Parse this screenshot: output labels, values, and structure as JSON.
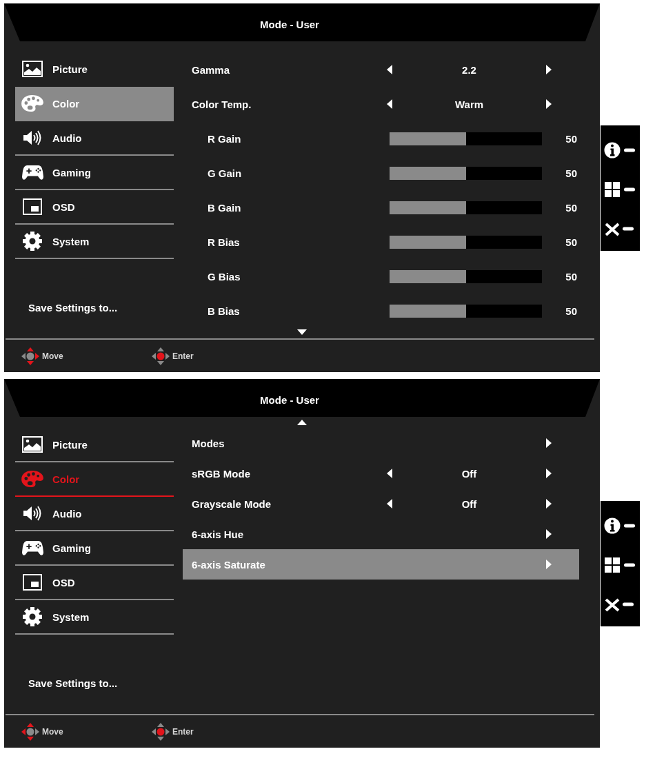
{
  "panels": [
    {
      "title": "Mode - User",
      "scroll_up": false,
      "scroll_down": true,
      "sidebar": {
        "active": true,
        "items": [
          {
            "label": "Picture",
            "selected": false
          },
          {
            "label": "Color",
            "selected": true
          },
          {
            "label": "Audio",
            "selected": false
          },
          {
            "label": "Gaming",
            "selected": false
          },
          {
            "label": "OSD",
            "selected": false
          },
          {
            "label": "System",
            "selected": false
          }
        ],
        "save_label": "Save Settings to..."
      },
      "settings": [
        {
          "kind": "choice",
          "label": "Gamma",
          "value": "2.2",
          "selected": false
        },
        {
          "kind": "choice",
          "label": "Color Temp.",
          "value": "Warm",
          "selected": false,
          "children": [
            {
              "kind": "slider",
              "label": "R Gain",
              "level": 0.5,
              "reading": "50",
              "selected": false
            },
            {
              "kind": "slider",
              "label": "G Gain",
              "level": 0.5,
              "reading": "50",
              "selected": false
            },
            {
              "kind": "slider",
              "label": "B Gain",
              "level": 0.5,
              "reading": "50",
              "selected": false
            },
            {
              "kind": "slider",
              "label": "R Bias",
              "level": 0.5,
              "reading": "50",
              "selected": false
            },
            {
              "kind": "slider",
              "label": "G Bias",
              "level": 0.5,
              "reading": "50",
              "selected": false
            },
            {
              "kind": "slider",
              "label": "B Bias",
              "level": 0.5,
              "reading": "50",
              "selected": false
            }
          ]
        }
      ],
      "hints": [
        {
          "label": "Move",
          "up": true,
          "down": true,
          "left": false,
          "right": true,
          "center": false
        },
        {
          "label": "Enter",
          "up": false,
          "down": false,
          "left": false,
          "right": false,
          "center": true
        }
      ]
    },
    {
      "title": "Mode - User",
      "scroll_up": true,
      "scroll_down": false,
      "sidebar": {
        "active": false,
        "items": [
          {
            "label": "Picture",
            "selected": false
          },
          {
            "label": "Color",
            "selected": true
          },
          {
            "label": "Audio",
            "selected": false
          },
          {
            "label": "Gaming",
            "selected": false
          },
          {
            "label": "OSD",
            "selected": false
          },
          {
            "label": "System",
            "selected": false
          }
        ],
        "save_label": "Save Settings to..."
      },
      "settings": [
        {
          "kind": "link",
          "label": "Modes",
          "selected": false
        },
        {
          "kind": "choice",
          "label": "sRGB Mode",
          "value": "Off",
          "selected": false
        },
        {
          "kind": "choice",
          "label": "Grayscale Mode",
          "value": "Off",
          "selected": false
        },
        {
          "kind": "link",
          "label": "6-axis Hue",
          "selected": false
        },
        {
          "kind": "link",
          "label": "6-axis Saturate",
          "selected": true
        }
      ],
      "hints": [
        {
          "label": "Move",
          "up": true,
          "down": true,
          "left": true,
          "right": false,
          "center": false
        },
        {
          "label": "Enter",
          "up": false,
          "down": false,
          "left": false,
          "right": false,
          "center": true
        }
      ]
    }
  ]
}
